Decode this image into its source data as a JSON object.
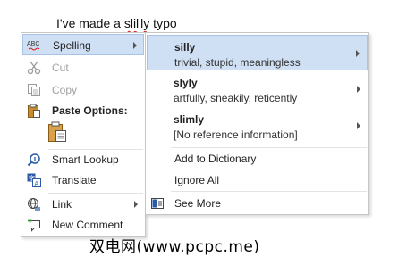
{
  "document": {
    "text_before": "I've made a ",
    "misspelled_word_a": "slil",
    "misspelled_word_b": "ly",
    "text_after": " typo"
  },
  "context_menu": {
    "items": [
      {
        "label": "Spelling",
        "icon": "spelling-abc-icon",
        "state": "highlighted",
        "submenu": true
      },
      {
        "label": "Cut",
        "icon": "scissors-icon",
        "state": "disabled"
      },
      {
        "label": "Copy",
        "icon": "copy-icon",
        "state": "disabled"
      },
      {
        "label": "Paste Options:",
        "icon": "clipboard-icon",
        "state": "bold"
      },
      {
        "label": "Smart Lookup",
        "icon": "search-icon",
        "state": "normal"
      },
      {
        "label": "Translate",
        "icon": "translate-icon",
        "state": "normal"
      },
      {
        "label": "Link",
        "icon": "globe-link-icon",
        "state": "normal",
        "submenu": true
      },
      {
        "label": "New Comment",
        "icon": "new-comment-icon",
        "state": "normal"
      }
    ]
  },
  "spelling_submenu": {
    "suggestions": [
      {
        "word": "silly",
        "description": "trivial, stupid, meaningless",
        "highlighted": true
      },
      {
        "word": "slyly",
        "description": "artfully, sneakily, reticently"
      },
      {
        "word": "slimly",
        "description": "[No reference information]"
      }
    ],
    "actions": [
      {
        "label": "Add to Dictionary"
      },
      {
        "label": "Ignore All"
      },
      {
        "label": "See More",
        "icon": "book-icon"
      }
    ]
  },
  "watermark": "双电网(www.pcpc.me)",
  "colors": {
    "highlight": "#cfdff4",
    "highlight_border": "#a9c3e6",
    "spell_error": "#d21f1f",
    "disabled_text": "#a0a0a0"
  }
}
